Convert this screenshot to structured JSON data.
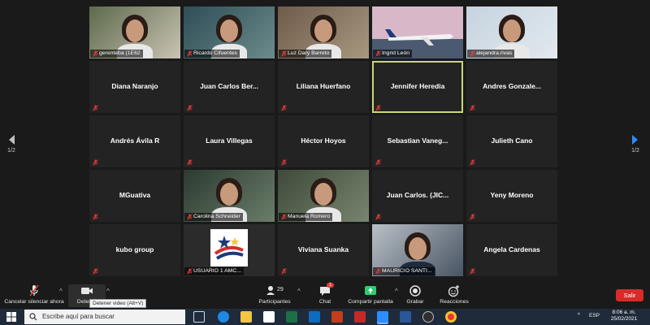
{
  "participants": [
    {
      "name": "gerenteba (1E62",
      "kind": "video"
    },
    {
      "name": "Ricardo Cifuentes",
      "kind": "video"
    },
    {
      "name": "Luz Dary Barreto",
      "kind": "video"
    },
    {
      "name": "Ingrid León",
      "kind": "video"
    },
    {
      "name": "alejandra.rivas",
      "kind": "video"
    },
    {
      "name": "Diana Naranjo",
      "kind": "name"
    },
    {
      "name": "Juan Carlos Ber...",
      "kind": "name"
    },
    {
      "name": "Liliana Huerfano",
      "kind": "name"
    },
    {
      "name": "Jennifer Heredia",
      "kind": "name",
      "active": true
    },
    {
      "name": "Andres  Gonzale...",
      "kind": "name"
    },
    {
      "name": "Andrés Ávila R",
      "kind": "name"
    },
    {
      "name": "Laura Villegas",
      "kind": "name"
    },
    {
      "name": "Héctor Hoyos",
      "kind": "name"
    },
    {
      "name": "Sebastian  Vaneg...",
      "kind": "name"
    },
    {
      "name": "Julieth Cano",
      "kind": "name"
    },
    {
      "name": "MGuativa",
      "kind": "name"
    },
    {
      "name": "Carolina Schneider",
      "kind": "video"
    },
    {
      "name": "Manuela Romero",
      "kind": "video"
    },
    {
      "name": "Juan Carlos. (JIC...",
      "kind": "name"
    },
    {
      "name": "Yeny Moreno",
      "kind": "name"
    },
    {
      "name": "kubo group",
      "kind": "name"
    },
    {
      "name": "USUARIO 1 AMC...",
      "kind": "video"
    },
    {
      "name": "Viviana Suanka",
      "kind": "name"
    },
    {
      "name": "MAURICIO SANTI...",
      "kind": "video"
    },
    {
      "name": "Angela Cardenas",
      "kind": "name"
    }
  ],
  "pager": {
    "left": "1/2",
    "right": "1/2"
  },
  "toolbar": {
    "unmute": "Cancelar silenciar ahora",
    "stop_video": "Detener",
    "participants": "Participantes",
    "participants_count": "29",
    "chat": "Chat",
    "chat_badge": "1",
    "share": "Compartir pantalla",
    "record": "Grabar",
    "reactions": "Reacciones",
    "leave": "Salir",
    "tooltip": "Detener video (Alt+V)"
  },
  "taskbar": {
    "search_placeholder": "Escribe aquí para buscar",
    "language": "ESP",
    "time": "8:06 a. m.",
    "date": "25/02/2021"
  },
  "colors": {
    "active_border": "#c9d77a",
    "leave": "#d92a2a",
    "share": "#2ecc71",
    "mic_off": "#e23b3b"
  }
}
